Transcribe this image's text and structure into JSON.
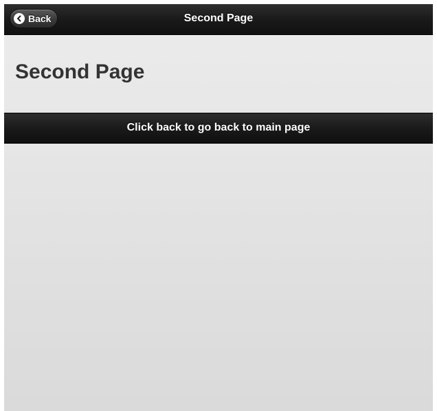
{
  "header": {
    "back_label": "Back",
    "title": "Second Page",
    "back_icon": "chevron-left-icon"
  },
  "content": {
    "heading": "Second Page"
  },
  "footer": {
    "text": "Click back to go back to main page"
  },
  "colors": {
    "bar_dark": "#1a1a1a",
    "page_bg": "#e6e6e6",
    "heading_text": "#333333",
    "bar_text": "#ffffff"
  }
}
